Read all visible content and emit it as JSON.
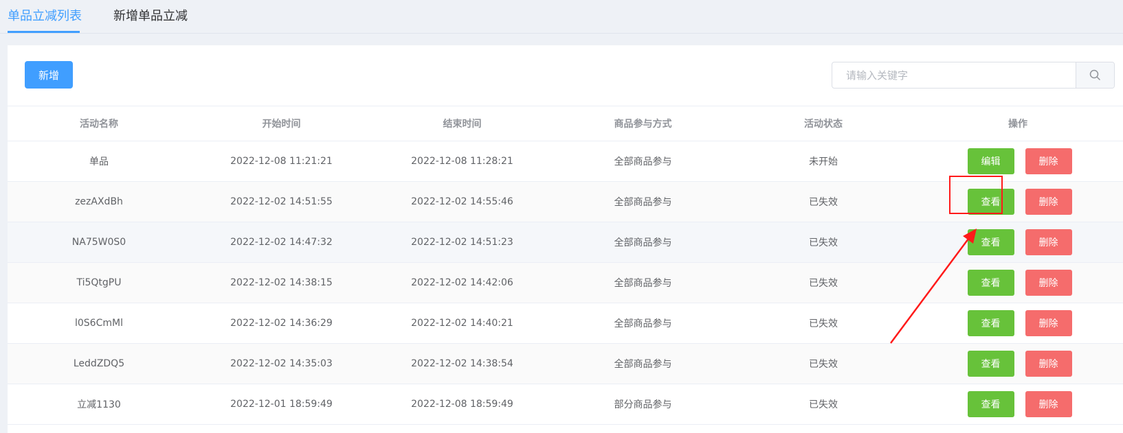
{
  "tabs": [
    {
      "label": "单品立减列表",
      "active": true
    },
    {
      "label": "新增单品立减",
      "active": false
    }
  ],
  "toolbar": {
    "add_label": "新增"
  },
  "search": {
    "placeholder": "请输入关键字",
    "value": "",
    "icon": "search-icon"
  },
  "table": {
    "headers": [
      "活动名称",
      "开始时间",
      "结束时间",
      "商品参与方式",
      "活动状态",
      "操作"
    ],
    "rows": [
      {
        "name": "单品",
        "start": "2022-12-08 11:21:21",
        "end": "2022-12-08 11:28:21",
        "mode": "全部商品参与",
        "status": "未开始",
        "action": "编辑",
        "delete": "删除"
      },
      {
        "name": "zezAXdBh",
        "start": "2022-12-02 14:51:55",
        "end": "2022-12-02 14:55:46",
        "mode": "全部商品参与",
        "status": "已失效",
        "action": "查看",
        "delete": "删除"
      },
      {
        "name": "NA75W0S0",
        "start": "2022-12-02 14:47:32",
        "end": "2022-12-02 14:51:23",
        "mode": "全部商品参与",
        "status": "已失效",
        "action": "查看",
        "delete": "删除"
      },
      {
        "name": "Ti5QtgPU",
        "start": "2022-12-02 14:38:15",
        "end": "2022-12-02 14:42:06",
        "mode": "全部商品参与",
        "status": "已失效",
        "action": "查看",
        "delete": "删除"
      },
      {
        "name": "l0S6CmMl",
        "start": "2022-12-02 14:36:29",
        "end": "2022-12-02 14:40:21",
        "mode": "全部商品参与",
        "status": "已失效",
        "action": "查看",
        "delete": "删除"
      },
      {
        "name": "LeddZDQ5",
        "start": "2022-12-02 14:35:03",
        "end": "2022-12-02 14:38:54",
        "mode": "全部商品参与",
        "status": "已失效",
        "action": "查看",
        "delete": "删除"
      },
      {
        "name": "立减1130",
        "start": "2022-12-01 18:59:49",
        "end": "2022-12-08 18:59:49",
        "mode": "部分商品参与",
        "status": "已失效",
        "action": "查看",
        "delete": "删除"
      }
    ]
  },
  "colors": {
    "primary": "#409eff",
    "success": "#67c23a",
    "danger": "#f56c6c",
    "annotation": "#ff1a1a"
  }
}
